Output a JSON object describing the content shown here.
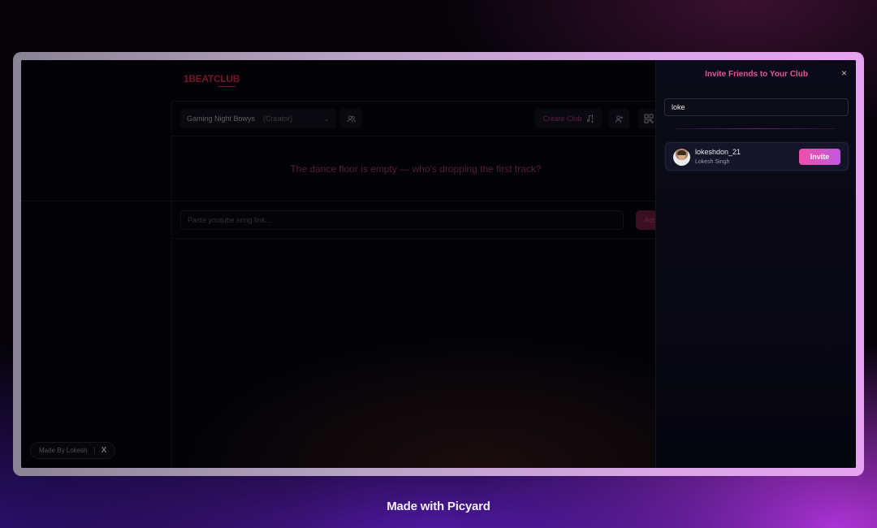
{
  "app": {
    "logo": "1BEATCLUB",
    "club_name": "Gaming Night Bowys",
    "club_role": "(Creator)",
    "create_club_label": "Create Club",
    "empty_message": "The dance floor is empty — who's dropping the first track?",
    "song_input_placeholder": "Paste youtube song link...",
    "add_button_label": "Add",
    "made_by_label": "Made By Lokesh",
    "x_icon": "X"
  },
  "invite_panel": {
    "title": "Invite Friends to Your Club",
    "close_icon": "×",
    "search_value": "loke",
    "results": [
      {
        "username": "lokeshdon_21",
        "full_name": "Lokesh Singh",
        "action_label": "Invite"
      }
    ]
  },
  "colors": {
    "accent_pink": "#ee4fa8",
    "accent_purple": "#c05ae0",
    "title_pink": "#e0559c",
    "logo_red": "#b0243f"
  },
  "watermark": "Made with Picyard"
}
